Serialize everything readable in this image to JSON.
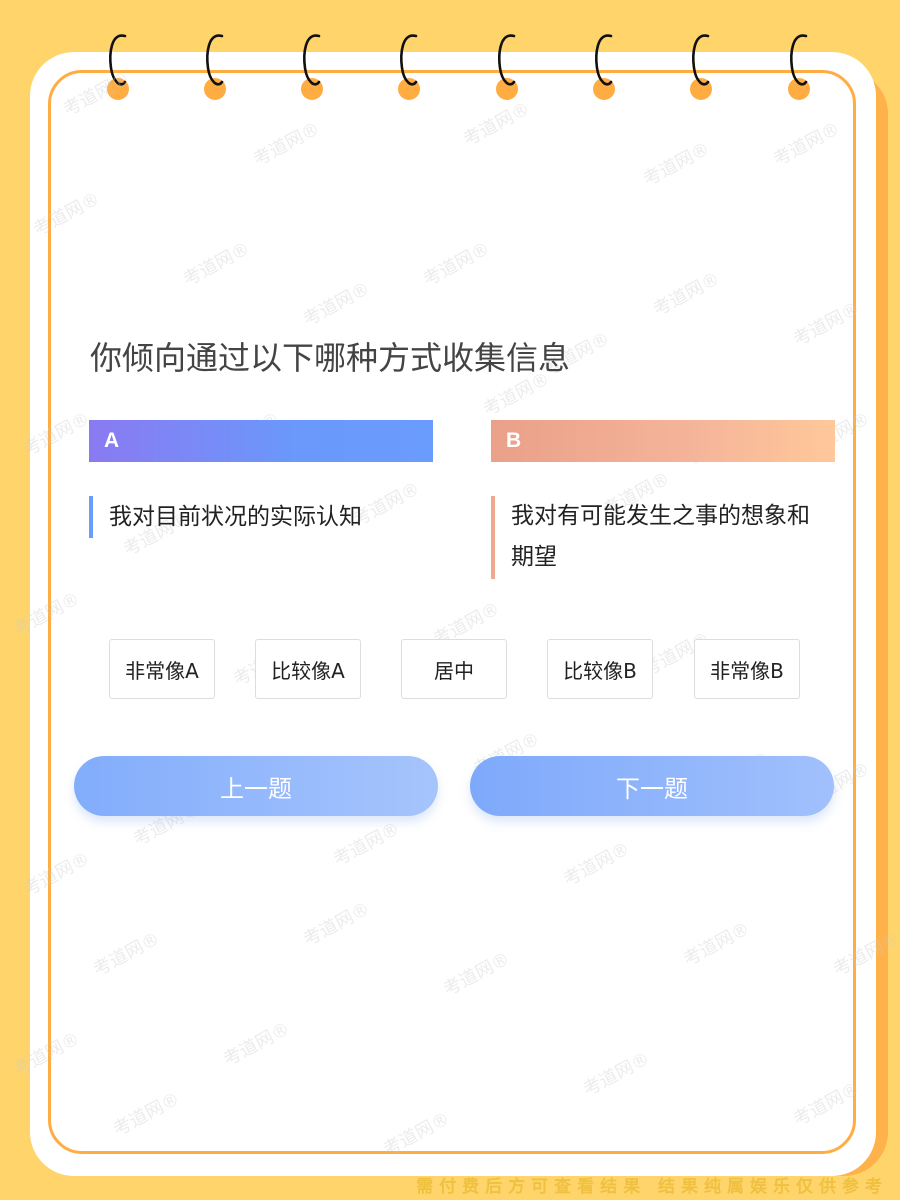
{
  "question": "你倾向通过以下哪种方式收集信息",
  "options": [
    {
      "letter": "A",
      "text": "我对目前状况的实际认知"
    },
    {
      "letter": "B",
      "text": "我对有可能发生之事的想象和期望"
    }
  ],
  "scale": [
    "非常像A",
    "比较像A",
    "居中",
    "比较像B",
    "非常像B"
  ],
  "nav": {
    "prev": "上一题",
    "next": "下一题"
  },
  "watermark": "考道网®",
  "footer_note": "需付费后方可查看结果 结果纯属娱乐仅供参考",
  "colors": {
    "background": "#ffd56b",
    "accent_orange": "#ffad42",
    "option_a": "#6a9cfd",
    "option_b": "#f0a98d",
    "button_blue": "#82adfb"
  }
}
